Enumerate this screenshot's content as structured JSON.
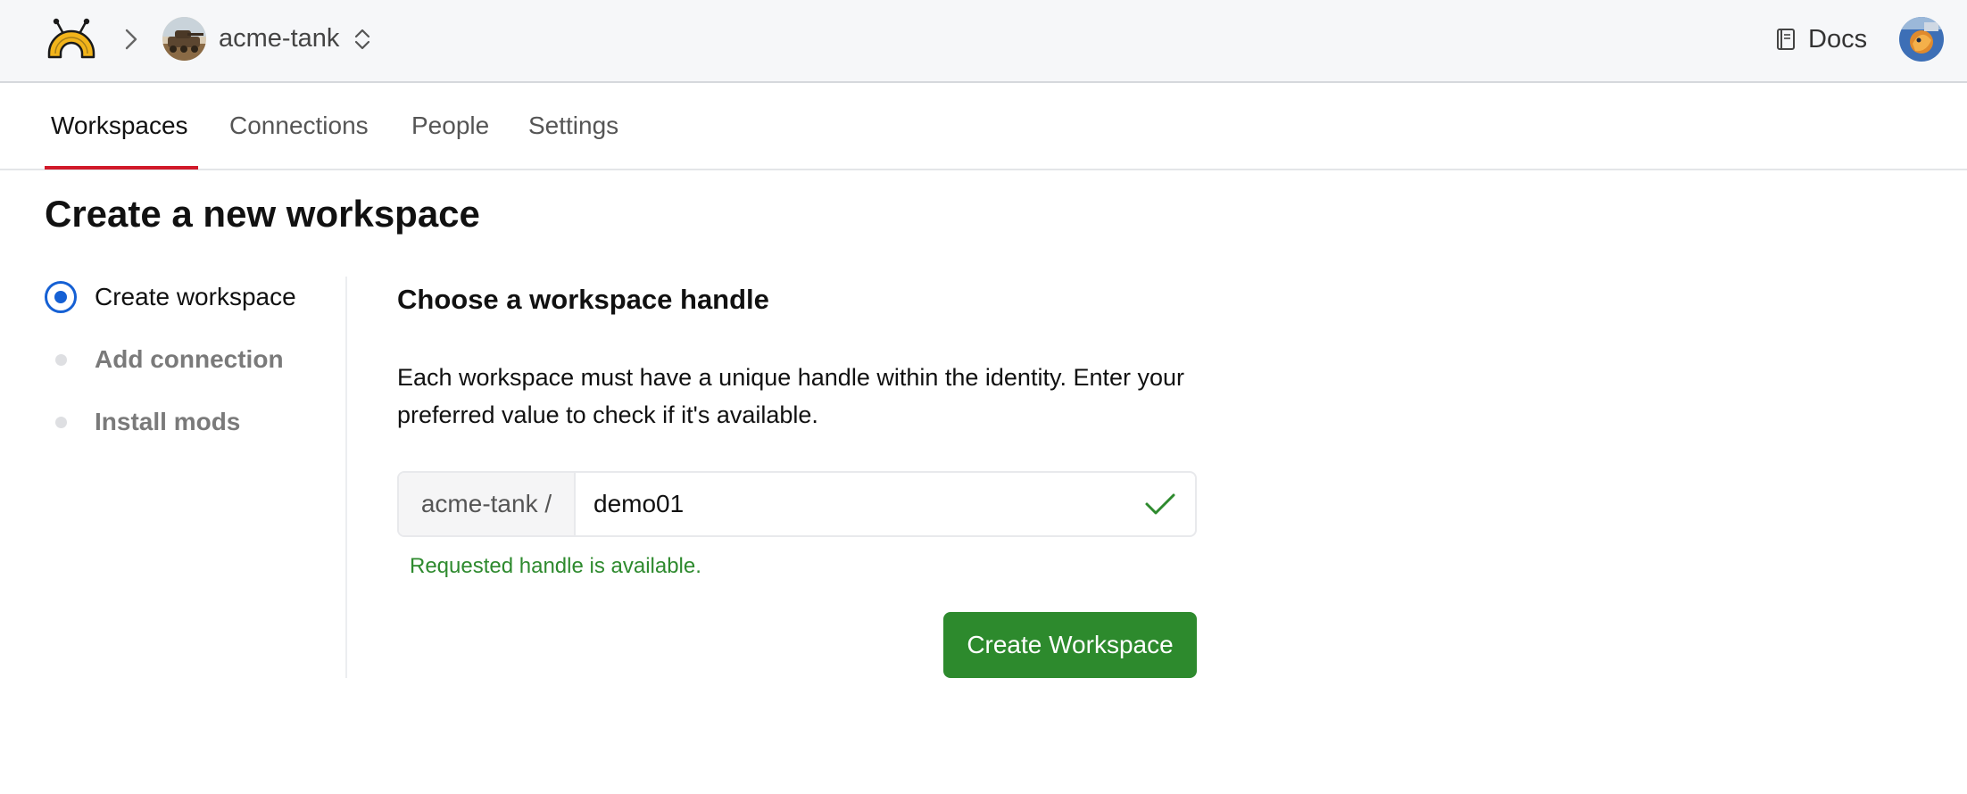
{
  "header": {
    "logo_icon": "steampipe-logo-icon",
    "breadcrumb_separator_icon": "chevron-right-icon",
    "org_name": "acme-tank",
    "org_switch_icon": "up-down-chevron-icon",
    "docs_label": "Docs",
    "docs_icon": "book-icon"
  },
  "tabs": [
    {
      "label": "Workspaces",
      "active": true
    },
    {
      "label": "Connections",
      "active": false
    },
    {
      "label": "People",
      "active": false
    },
    {
      "label": "Settings",
      "active": false
    }
  ],
  "page": {
    "title": "Create a new workspace"
  },
  "steps": [
    {
      "label": "Create workspace",
      "state": "current"
    },
    {
      "label": "Add connection",
      "state": "pending"
    },
    {
      "label": "Install mods",
      "state": "pending"
    }
  ],
  "form": {
    "section_title": "Choose a workspace handle",
    "description": "Each workspace must have a unique handle within the identity. Enter your preferred value to check if it's available.",
    "handle_prefix": "acme-tank /",
    "handle_value": "demo01",
    "valid_icon": "checkmark-icon",
    "status_message": "Requested handle is available.",
    "submit_label": "Create Workspace"
  },
  "colors": {
    "accent_tab": "#d11a2a",
    "step_active": "#1560d4",
    "success": "#2e8a2e",
    "button": "#2d8a2d",
    "logo": "#f2b41b"
  }
}
